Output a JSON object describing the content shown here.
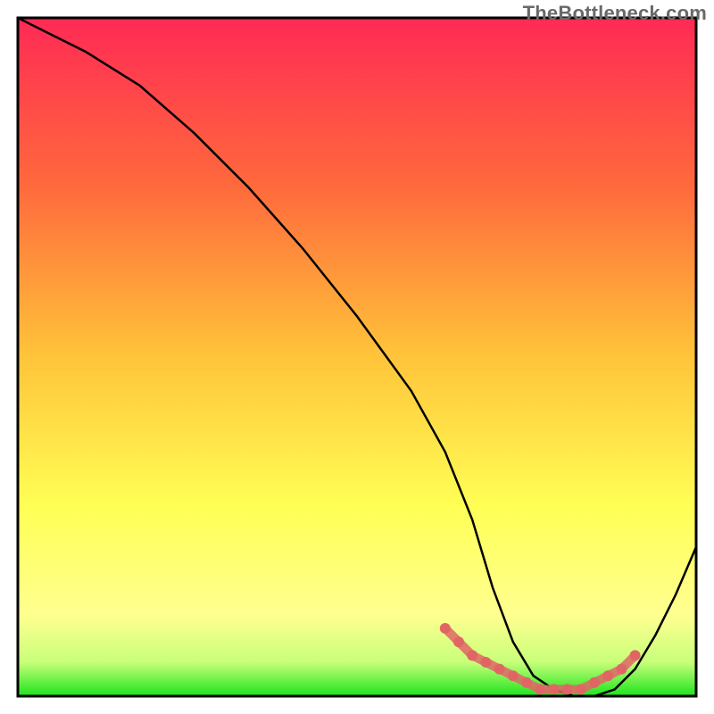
{
  "watermark": "TheBottleneck.com",
  "chart_data": {
    "type": "line",
    "title": "",
    "xlabel": "",
    "ylabel": "",
    "xlim": [
      0,
      100
    ],
    "ylim": [
      0,
      100
    ],
    "background_gradient": {
      "stops": [
        {
          "offset": 0,
          "color": "#ff2a55"
        },
        {
          "offset": 25,
          "color": "#ff6a3c"
        },
        {
          "offset": 50,
          "color": "#ffc43a"
        },
        {
          "offset": 72,
          "color": "#ffff55"
        },
        {
          "offset": 88,
          "color": "#ffff90"
        },
        {
          "offset": 95,
          "color": "#c8ff7a"
        },
        {
          "offset": 100,
          "color": "#1de41d"
        }
      ]
    },
    "series": [
      {
        "name": "bottleneck-curve",
        "color": "#000000",
        "x": [
          0,
          4,
          10,
          18,
          26,
          34,
          42,
          50,
          58,
          63,
          67,
          70,
          73,
          76,
          79,
          82,
          85,
          88,
          91,
          94,
          97,
          100
        ],
        "values": [
          100,
          98,
          95,
          90,
          83,
          75,
          66,
          56,
          45,
          36,
          26,
          16,
          8,
          3,
          1,
          0,
          0,
          1,
          4,
          9,
          15,
          22
        ]
      },
      {
        "name": "optimal-region-markers",
        "color": "#e06666",
        "type": "scatter",
        "x": [
          63,
          65,
          67,
          69,
          71,
          73,
          75,
          77,
          79,
          81,
          83,
          85,
          87,
          89,
          91
        ],
        "values": [
          10,
          8,
          6,
          5,
          4,
          3,
          2,
          1,
          1,
          1,
          1,
          2,
          3,
          4,
          6
        ]
      }
    ],
    "annotations": []
  }
}
